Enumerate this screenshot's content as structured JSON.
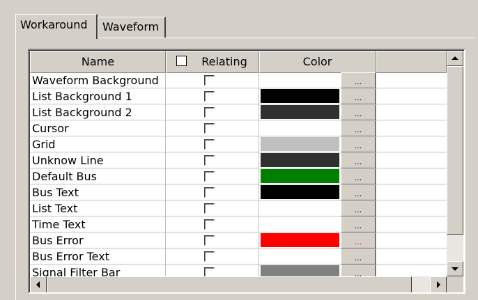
{
  "tabs": [
    {
      "label": "Workaround",
      "active": true
    },
    {
      "label": "Waveform",
      "active": false
    }
  ],
  "table": {
    "columns": {
      "name": "Name",
      "relating": "Relating",
      "color": "Color"
    },
    "header_checkbox_checked": false,
    "button_label": "...",
    "rows": [
      {
        "name": "Waveform Background",
        "relating": false,
        "color": "#ffffff"
      },
      {
        "name": "List Background 1",
        "relating": false,
        "color": "#000000"
      },
      {
        "name": "List Background 2",
        "relating": false,
        "color": "#303030"
      },
      {
        "name": "Cursor",
        "relating": false,
        "color": "#ffffff"
      },
      {
        "name": "Grid",
        "relating": false,
        "color": "#c0c0c0"
      },
      {
        "name": "Unknow Line",
        "relating": false,
        "color": "#303030"
      },
      {
        "name": "Default Bus",
        "relating": false,
        "color": "#008000"
      },
      {
        "name": "Bus Text",
        "relating": false,
        "color": "#000000"
      },
      {
        "name": "List Text",
        "relating": false,
        "color": "#ffffff"
      },
      {
        "name": "Time Text",
        "relating": false,
        "color": "#ffffff"
      },
      {
        "name": "Bus Error",
        "relating": false,
        "color": "#ff0000"
      },
      {
        "name": "Bus Error Text",
        "relating": false,
        "color": "#ffffff"
      },
      {
        "name": "Signal Filter Bar",
        "relating": false,
        "color": "#808080"
      }
    ]
  },
  "scrollbars": {
    "vertical": {
      "up": "up-arrow",
      "down": "down-arrow"
    },
    "horizontal": {
      "left": "left-arrow",
      "right": "right-arrow"
    }
  }
}
